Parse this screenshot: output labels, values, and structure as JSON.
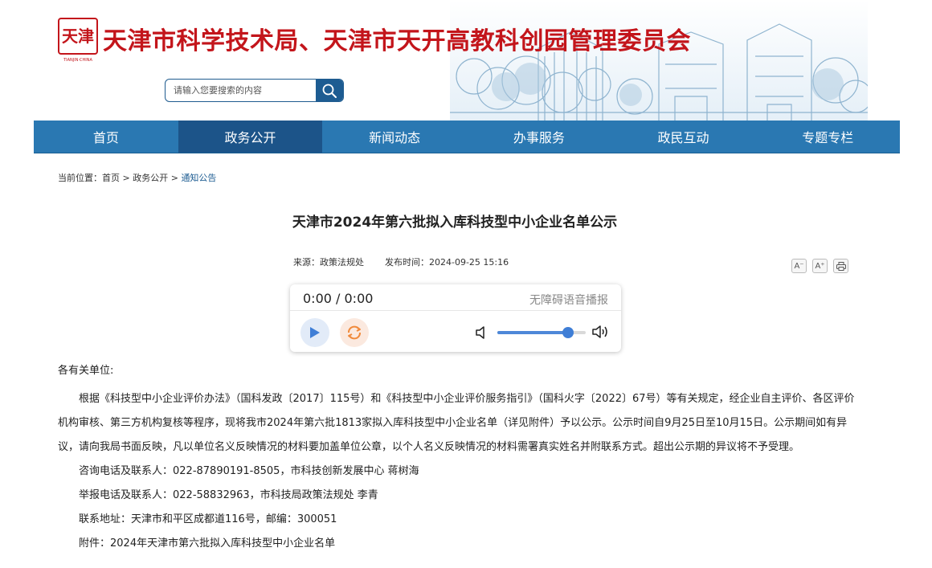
{
  "header": {
    "seal_text": "天津",
    "seal_caption": "TIANJIN·CHINA",
    "site_title": "天津市科学技术局、天津市天开高教科创园管理委员会",
    "search_placeholder": "请输入您要搜索的内容"
  },
  "nav": {
    "items": [
      {
        "label": "首页"
      },
      {
        "label": "政务公开"
      },
      {
        "label": "新闻动态"
      },
      {
        "label": "办事服务"
      },
      {
        "label": "政民互动"
      },
      {
        "label": "专题专栏"
      }
    ],
    "active_index": 1
  },
  "breadcrumb": {
    "prefix": "当前位置：",
    "items": [
      "首页",
      "政务公开",
      "通知公告"
    ],
    "separator": ">"
  },
  "article": {
    "title": "天津市2024年第六批拟入库科技型中小企业名单公示",
    "source": "来源：政策法规处",
    "publish_time": "发布时间：2024-09-25 15:16",
    "tools": {
      "font_smaller": "A⁻",
      "font_larger": "A⁺"
    }
  },
  "player": {
    "time": "0:00 / 0:00",
    "label": "无障碍语音播报",
    "volume": 0.8
  },
  "content": {
    "salutation": "各有关单位:",
    "paragraph": "根据《科技型中小企业评价办法》（国科发政〔2017〕115号）和《科技型中小企业评价服务指引》（国科火字〔2022〕67号）等有关规定，经企业自主评价、各区评价机构审核、第三方机构复核等程序，现将我市2024年第六批1813家拟入库科技型中小企业名单（详见附件）予以公示。公示时间自9月25日至10月15日。公示期间如有异议，请向我局书面反映，凡以单位名义反映情况的材料要加盖单位公章，以个人名义反映情况的材料需署真实姓名并附联系方式。超出公示期的异议将不予受理。",
    "consult": "咨询电话及联系人：022-87890191-8505，市科技创新发展中心 蒋树海",
    "report": "举报电话及联系人：022-58832963，市科技局政策法规处 李青",
    "address": "联系地址：天津市和平区成都道116号，邮编：300051",
    "attachment": "附件：2024年天津市第六批拟入库科技型中小企业名单"
  },
  "colors": {
    "title_red": "#c3151b",
    "nav_blue": "#2a78b2",
    "nav_active": "#1c5489",
    "link_blue": "#1d5c92"
  }
}
